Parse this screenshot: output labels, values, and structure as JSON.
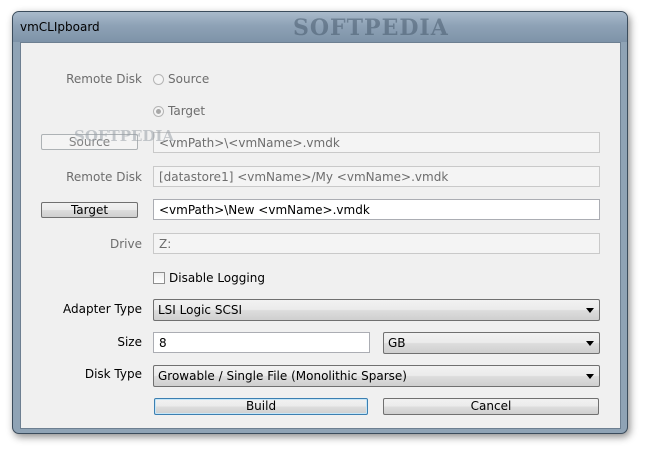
{
  "window": {
    "title": "vmCLIpboard",
    "watermark": "SOFTPEDIA"
  },
  "form": {
    "remote_disk_label_1": "Remote Disk",
    "radio_source_label": "Source",
    "radio_target_label": "Target",
    "source_button_label": "Source",
    "source_path_value": "<vmPath>\\<vmName>.vmdk",
    "remote_disk_label_2": "Remote Disk",
    "remote_disk_path_value": "[datastore1] <vmName>/My <vmName>.vmdk",
    "target_button_label": "Target",
    "target_path_value": "<vmPath>\\New <vmName>.vmdk",
    "drive_label": "Drive",
    "drive_value": "Z:",
    "disable_logging_label": "Disable Logging",
    "disable_logging_checked": false,
    "adapter_type_label": "Adapter Type",
    "adapter_type_value": "LSI Logic SCSI",
    "size_label": "Size",
    "size_value": "8",
    "size_unit_value": "GB",
    "disk_type_label": "Disk Type",
    "disk_type_value": "Growable / Single File (Monolithic Sparse)",
    "build_button_label": "Build",
    "cancel_button_label": "Cancel",
    "selected_radio": "Target"
  },
  "overlay_watermark": "SOFTPEDIA"
}
